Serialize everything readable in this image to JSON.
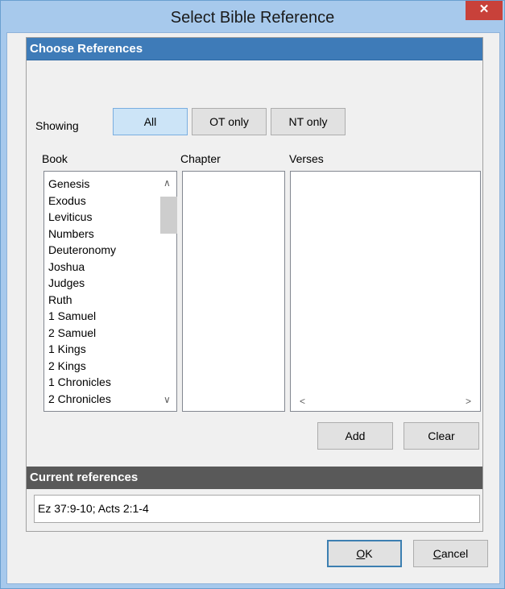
{
  "window": {
    "title": "Select Bible Reference",
    "close_glyph": "✕"
  },
  "choose": {
    "header": "Choose References",
    "showing_label": "Showing",
    "filter_buttons": [
      "All",
      "OT only",
      "NT only"
    ],
    "selected_filter": "All",
    "book_label": "Book",
    "chapter_label": "Chapter",
    "verses_label": "Verses",
    "books": [
      "Genesis",
      "Exodus",
      "Leviticus",
      "Numbers",
      "Deuteronomy",
      "Joshua",
      "Judges",
      "Ruth",
      "1 Samuel",
      "2 Samuel",
      "1 Kings",
      "2 Kings",
      "1 Chronicles",
      "2 Chronicles"
    ],
    "add_label": "Add",
    "clear_label": "Clear"
  },
  "current": {
    "header": "Current references",
    "value": "Ez 37:9-10; Acts 2:1-4"
  },
  "footer": {
    "ok_mnemonic": "O",
    "ok_rest": "K",
    "cancel_mnemonic": "C",
    "cancel_rest": "ancel"
  },
  "icons": {
    "scroll_up": "chevron-up-icon",
    "scroll_down": "chevron-down-icon",
    "scroll_left": "chevron-left-icon",
    "scroll_right": "chevron-right-icon"
  }
}
